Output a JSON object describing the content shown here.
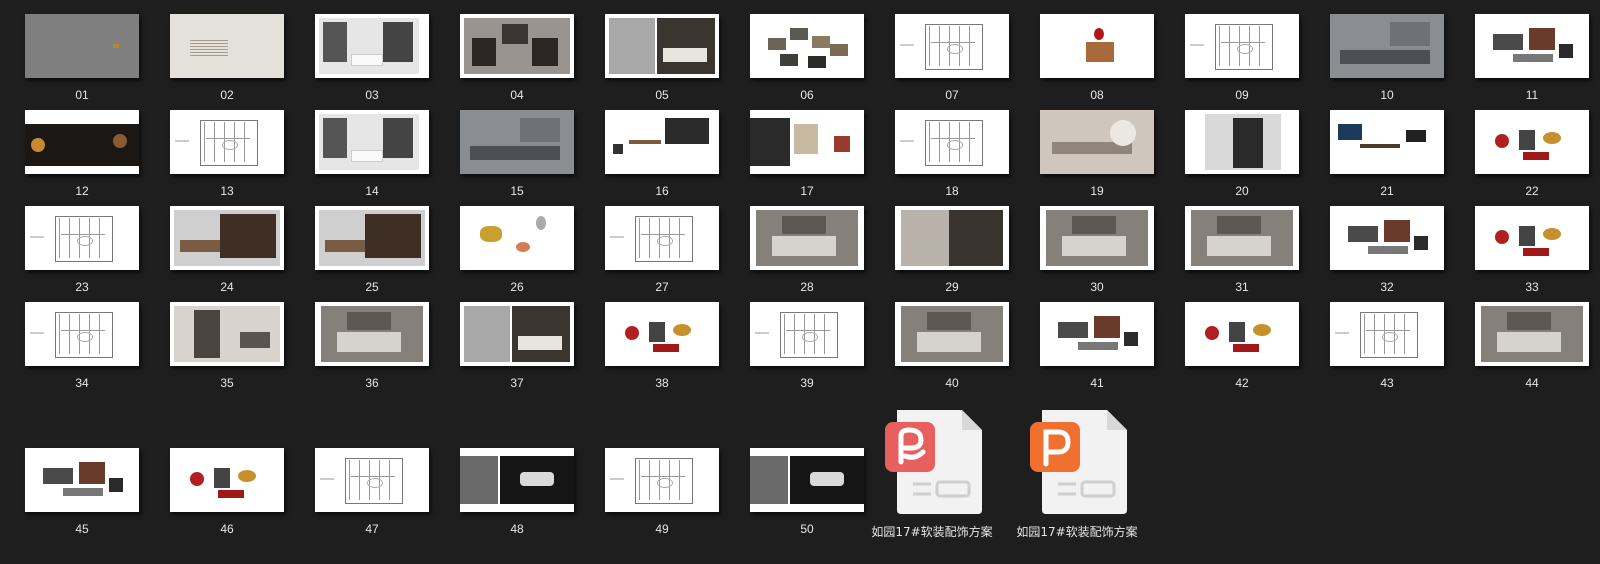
{
  "window": {
    "background": "#1e1e1e"
  },
  "thumbnails": [
    {
      "label": "01",
      "kind": "gray"
    },
    {
      "label": "02",
      "kind": "beige"
    },
    {
      "label": "03",
      "kind": "interior-light"
    },
    {
      "label": "04",
      "kind": "interior-dark"
    },
    {
      "label": "05",
      "kind": "bedroom-collage"
    },
    {
      "label": "06",
      "kind": "swatches"
    },
    {
      "label": "07",
      "kind": "floorplan"
    },
    {
      "label": "08",
      "kind": "object"
    },
    {
      "label": "09",
      "kind": "floorplan"
    },
    {
      "label": "10",
      "kind": "living-photo"
    },
    {
      "label": "11",
      "kind": "furniture-collage"
    },
    {
      "label": "12",
      "kind": "lights-collage"
    },
    {
      "label": "13",
      "kind": "floorplan"
    },
    {
      "label": "14",
      "kind": "interior-light"
    },
    {
      "label": "15",
      "kind": "living-photo"
    },
    {
      "label": "16",
      "kind": "study-collage"
    },
    {
      "label": "17",
      "kind": "shelf-collage"
    },
    {
      "label": "18",
      "kind": "floorplan"
    },
    {
      "label": "19",
      "kind": "dining-photo"
    },
    {
      "label": "20",
      "kind": "cabinet-photo"
    },
    {
      "label": "21",
      "kind": "dining-collage"
    },
    {
      "label": "22",
      "kind": "decor-collage"
    },
    {
      "label": "23",
      "kind": "floorplan"
    },
    {
      "label": "24",
      "kind": "kitchen-photo"
    },
    {
      "label": "25",
      "kind": "kitchen-photo"
    },
    {
      "label": "26",
      "kind": "tableware"
    },
    {
      "label": "27",
      "kind": "floorplan"
    },
    {
      "label": "28",
      "kind": "bedroom-photo"
    },
    {
      "label": "29",
      "kind": "wardrobe-photo"
    },
    {
      "label": "30",
      "kind": "bedroom-photo"
    },
    {
      "label": "31",
      "kind": "bedroom-photo"
    },
    {
      "label": "32",
      "kind": "furniture-collage"
    },
    {
      "label": "33",
      "kind": "decor-collage"
    },
    {
      "label": "34",
      "kind": "floorplan"
    },
    {
      "label": "35",
      "kind": "closet-photo"
    },
    {
      "label": "36",
      "kind": "bedroom-photo"
    },
    {
      "label": "37",
      "kind": "bedroom-collage"
    },
    {
      "label": "38",
      "kind": "decor-collage"
    },
    {
      "label": "39",
      "kind": "floorplan"
    },
    {
      "label": "40",
      "kind": "bedroom-photo"
    },
    {
      "label": "41",
      "kind": "furniture-collage"
    },
    {
      "label": "42",
      "kind": "decor-collage"
    },
    {
      "label": "43",
      "kind": "floorplan"
    },
    {
      "label": "44",
      "kind": "bedroom-photo"
    },
    {
      "label": "45",
      "kind": "furniture-collage"
    },
    {
      "label": "46",
      "kind": "decor-collage"
    },
    {
      "label": "47",
      "kind": "floorplan"
    },
    {
      "label": "48",
      "kind": "bath-collage"
    },
    {
      "label": "49",
      "kind": "floorplan"
    },
    {
      "label": "50",
      "kind": "bath-collage"
    }
  ],
  "files": [
    {
      "name": "如园17#软装配饰方案",
      "icon": "wps-presentation-icon",
      "accent": "#e8605e"
    },
    {
      "name": "如园17#软装配饰方案",
      "icon": "powerpoint-icon",
      "accent": "#f07030"
    }
  ]
}
